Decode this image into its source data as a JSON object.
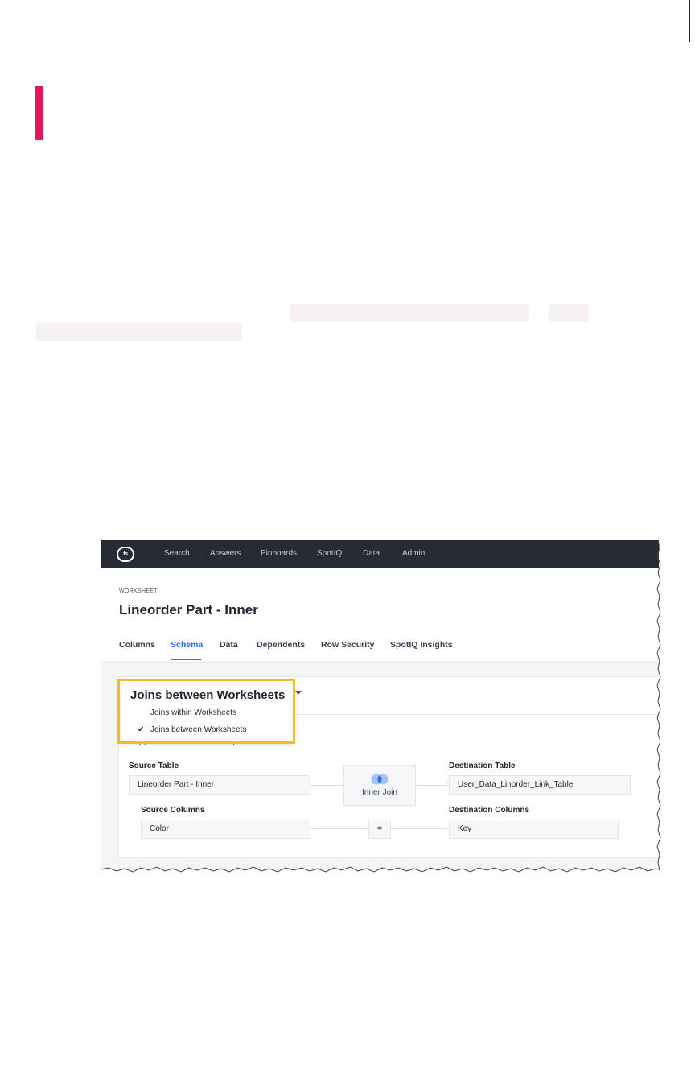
{
  "nav": {
    "logo": "ts",
    "items": [
      "Search",
      "Answers",
      "Pinboards",
      "SpotIQ",
      "Data",
      "Admin"
    ]
  },
  "header": {
    "subtitle": "WORKSHEET",
    "title": "Lineorder Part - Inner"
  },
  "tabs": [
    {
      "label": "Columns",
      "active": false
    },
    {
      "label": "Schema",
      "active": true
    },
    {
      "label": "Data",
      "active": false
    },
    {
      "label": "Dependents",
      "active": false
    },
    {
      "label": "Row Security",
      "active": false
    },
    {
      "label": "SpotIQ Insights",
      "active": false
    }
  ],
  "dropdown": {
    "selected": "Joins between Worksheets",
    "options": [
      {
        "label": "Joins within Worksheets",
        "checked": false
      },
      {
        "label": "Joins between Worksheets",
        "checked": true
      }
    ],
    "highlight_color": "#f2bd1c"
  },
  "join": {
    "description": "Copy of user table relationship",
    "source_table_label": "Source Table",
    "source_table": "Lineorder Part - Inner",
    "join_type": "Inner Join",
    "destination_table_label": "Destination Table",
    "destination_table": "User_Data_Linorder_Link_Table",
    "source_columns_label": "Source Columns",
    "source_column": "Color",
    "operator": "=",
    "destination_columns_label": "Destination Columns",
    "destination_column": "Key"
  },
  "colors": {
    "accent": "#e0195a",
    "nav_bg": "#262b34",
    "active_tab": "#2770ef"
  }
}
